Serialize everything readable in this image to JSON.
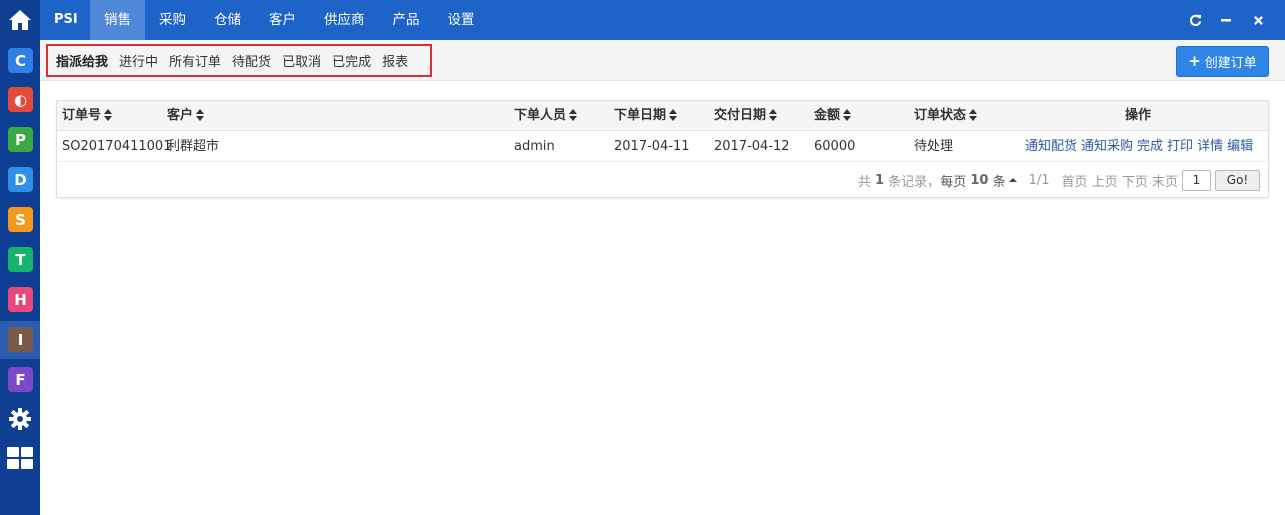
{
  "app": {
    "brand": "PSI"
  },
  "topnav": [
    {
      "label": "销售",
      "active": true
    },
    {
      "label": "采购",
      "active": false
    },
    {
      "label": "仓储",
      "active": false
    },
    {
      "label": "客户",
      "active": false
    },
    {
      "label": "供应商",
      "active": false
    },
    {
      "label": "产品",
      "active": false
    },
    {
      "label": "设置",
      "active": false
    }
  ],
  "rail": {
    "apps": [
      {
        "letter": "C",
        "color": "#2f7fe4"
      },
      {
        "letter": "◐",
        "color": "#e24a3a"
      },
      {
        "letter": "P",
        "color": "#3aa845"
      },
      {
        "letter": "D",
        "color": "#2f90e8"
      },
      {
        "letter": "S",
        "color": "#f29a1e"
      },
      {
        "letter": "T",
        "color": "#16b36a"
      },
      {
        "letter": "H",
        "color": "#e8487a"
      },
      {
        "letter": "I",
        "color": "#7a5a47"
      },
      {
        "letter": "F",
        "color": "#7c48c8"
      }
    ]
  },
  "filters": {
    "tabs": [
      "指派给我",
      "进行中",
      "所有订单",
      "待配货",
      "已取消",
      "已完成",
      "报表"
    ],
    "active_index": 0
  },
  "toolbar": {
    "create_label": "创建订单"
  },
  "table": {
    "columns": [
      "订单号",
      "客户",
      "下单人员",
      "下单日期",
      "交付日期",
      "金额",
      "订单状态",
      "操作"
    ],
    "rows": [
      {
        "order_no": "SO20170411001",
        "customer": "利群超市",
        "creator": "admin",
        "order_date": "2017-04-11",
        "delivery_date": "2017-04-12",
        "amount": "60000",
        "status": "待处理",
        "actions": [
          "通知配货",
          "通知采购",
          "完成",
          "打印",
          "详情",
          "编辑"
        ]
      }
    ]
  },
  "pager": {
    "total_prefix": "共",
    "total": "1",
    "total_suffix": "条记录，",
    "per_page_prefix": "每页",
    "per_page": "10",
    "per_page_suffix": "条",
    "page_info": "1/1",
    "first": "首页",
    "prev": "上页",
    "next": "下页",
    "last": "末页",
    "input_value": "1",
    "go_label": "Go!"
  },
  "colors": {
    "topbar": "#1e63c8",
    "rail": "#0f3f92",
    "highlight_border": "#d63131",
    "primary_button": "#2f85e3",
    "link": "#2a5aa8"
  }
}
